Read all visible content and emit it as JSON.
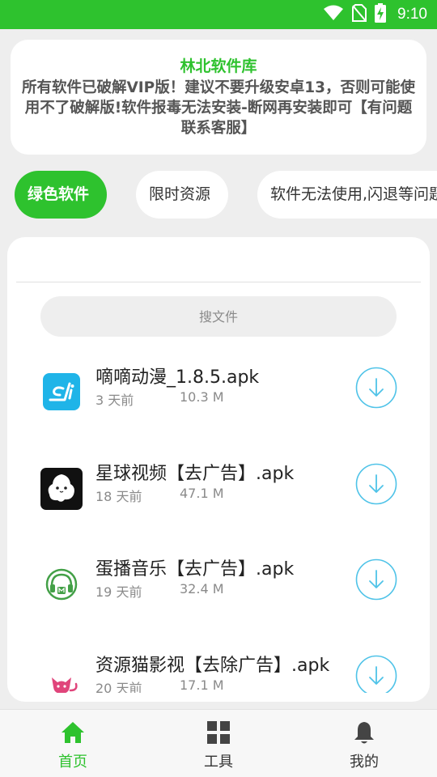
{
  "status_bar": {
    "time": "9:10",
    "icons": [
      "wifi-icon",
      "no-sim-icon",
      "battery-charging-icon"
    ]
  },
  "notice": {
    "title": "林北软件库",
    "body": "所有软件已破解VIP版！建议不要升级安卓13，否则可能使用不了破解版!软件报毒无法安装-断网再安装即可【有问题联系客服】"
  },
  "tabs": [
    {
      "label": "绿色软件",
      "active": true
    },
    {
      "label": "限时资源",
      "active": false
    },
    {
      "label": "软件无法使用,闪退等问题",
      "active": false
    }
  ],
  "search": {
    "placeholder": "搜文件"
  },
  "files": [
    {
      "name": "嘀嘀动漫_1.8.5.apk",
      "time": "3 天前",
      "size": "10.3 M",
      "icon": "didi-anime-app-icon"
    },
    {
      "name": "星球视频【去广告】.apk",
      "time": "18 天前",
      "size": "47.1 M",
      "icon": "planet-video-app-icon"
    },
    {
      "name": "蛋播音乐【去广告】.apk",
      "time": "19 天前",
      "size": "32.4 M",
      "icon": "danbo-music-app-icon"
    },
    {
      "name": "资源猫影视【去除广告】.apk",
      "time": "20 天前",
      "size": "17.1 M",
      "icon": "resource-cat-app-icon"
    }
  ],
  "bottom_nav": [
    {
      "label": "首页",
      "icon": "home-icon",
      "active": true
    },
    {
      "label": "工具",
      "icon": "tools-grid-icon",
      "active": false
    },
    {
      "label": "我的",
      "icon": "bell-icon",
      "active": false
    }
  ],
  "colors": {
    "accent": "#2ec22e",
    "download": "#4fc3e8",
    "background": "#eeeeee"
  }
}
